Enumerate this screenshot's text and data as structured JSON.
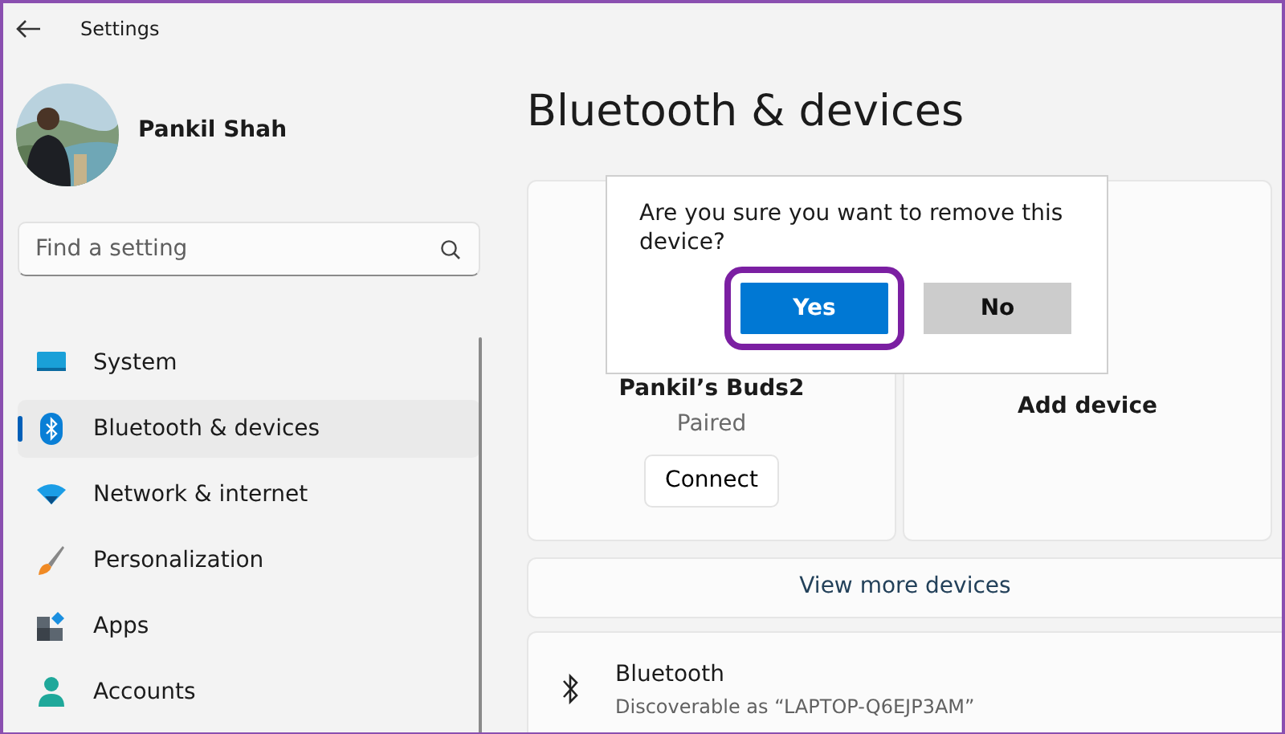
{
  "window": {
    "title": "Settings"
  },
  "user": {
    "name": "Pankil Shah"
  },
  "search": {
    "placeholder": "Find a setting"
  },
  "nav": [
    {
      "kind": "system",
      "label": "System",
      "selected": false
    },
    {
      "kind": "bluetooth",
      "label": "Bluetooth & devices",
      "selected": true
    },
    {
      "kind": "network",
      "label": "Network & internet",
      "selected": false
    },
    {
      "kind": "personalization",
      "label": "Personalization",
      "selected": false
    },
    {
      "kind": "apps",
      "label": "Apps",
      "selected": false
    },
    {
      "kind": "accounts",
      "label": "Accounts",
      "selected": false
    }
  ],
  "page": {
    "title": "Bluetooth & devices"
  },
  "cards": [
    {
      "kind": "device",
      "name": "Pankil’s Buds2",
      "status": "Paired",
      "action": "Connect"
    },
    {
      "kind": "add",
      "label": "Add device"
    }
  ],
  "view_more": "View more devices",
  "bluetooth": {
    "title": "Bluetooth",
    "subtitle": "Discoverable as “LAPTOP-Q6EJP3AM”"
  },
  "dialog": {
    "message": "Are you sure you want to remove this device?",
    "buttons": [
      {
        "label": "Yes",
        "primary": true,
        "highlighted": true
      },
      {
        "label": "No",
        "primary": false,
        "highlighted": false
      }
    ]
  }
}
